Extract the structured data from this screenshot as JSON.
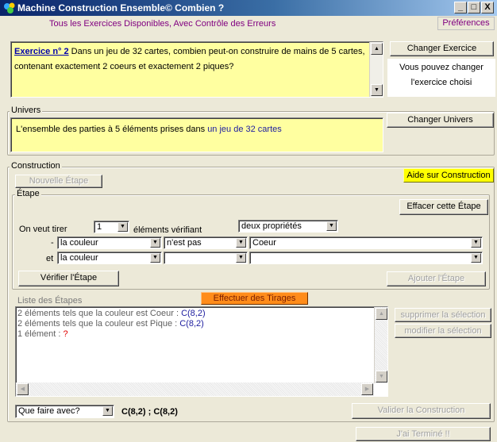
{
  "window": {
    "title": "Machine Construction Ensemble",
    "copyright": "© Combien ?",
    "minimize": "_",
    "maximize": "□",
    "close": "X"
  },
  "header": {
    "exercises_link": "Tous les Exercices Disponibles,  Avec Contrôle des Erreurs",
    "preferences": "Préférences"
  },
  "exercise": {
    "number": "Exercice n° 2",
    "text": " Dans un jeu de 32 cartes, combien peut-on construire de mains de 5 cartes, contenant exactement 2 coeurs et exactement 2 piques?",
    "change_button": "Changer Exercice",
    "hint_line1": "Vous pouvez changer",
    "hint_line2": "l'exercice choisi"
  },
  "univers": {
    "legend": "Univers",
    "text_prefix": "L'ensemble des parties à 5 éléments prises dans ",
    "text_link": "un jeu de 32 cartes",
    "change_button": "Changer Univers"
  },
  "construction": {
    "legend": "Construction",
    "new_step": "Nouvelle Étape",
    "help": "Aide sur Construction",
    "etape": {
      "legend": "Étape",
      "clear": "Effacer cette Étape",
      "want_draw": "On veut tirer",
      "count": "1",
      "elements_verifying": "éléments vérifiant",
      "properties": "deux propriétés",
      "row1": {
        "prefix": "-",
        "attr": "la couleur",
        "op": "n'est pas",
        "value": "Coeur"
      },
      "row2": {
        "prefix": "et",
        "attr": "la couleur",
        "op": "",
        "value": ""
      },
      "verify": "Vérifier l'Étape",
      "add": "Ajouter l'Étape"
    },
    "steps_legend": "Liste des Étapes",
    "draws_button": "Effectuer des Tirages",
    "steps": [
      {
        "text": "2 éléments tels que la couleur est Coeur : ",
        "formula": "C(8,2)"
      },
      {
        "text": "2 éléments tels que la couleur est Pique : ",
        "formula": "C(8,2)"
      },
      {
        "text": "1 élément  : ",
        "formula": "?"
      }
    ],
    "delete_selection": "supprimer la sélection",
    "modify_selection": "modifier la sélection",
    "what_to_do": "Que faire avec?",
    "result": "C(8,2) ;  C(8,2)",
    "validate": "Valider la Construction"
  },
  "finished": "J'ai Terminé !!",
  "colors": {
    "title_bar": "#0a246a",
    "background": "#ece9d8",
    "highlight_yellow": "#ffffa0",
    "draw_button": "#ff8c1a",
    "help_button": "#ffff00",
    "link": "#800080"
  },
  "icons": {
    "app": "app-icon",
    "scroll_up": "scroll-up-arrow-icon",
    "scroll_down": "scroll-down-arrow-icon",
    "combo": "chevron-down-icon"
  }
}
